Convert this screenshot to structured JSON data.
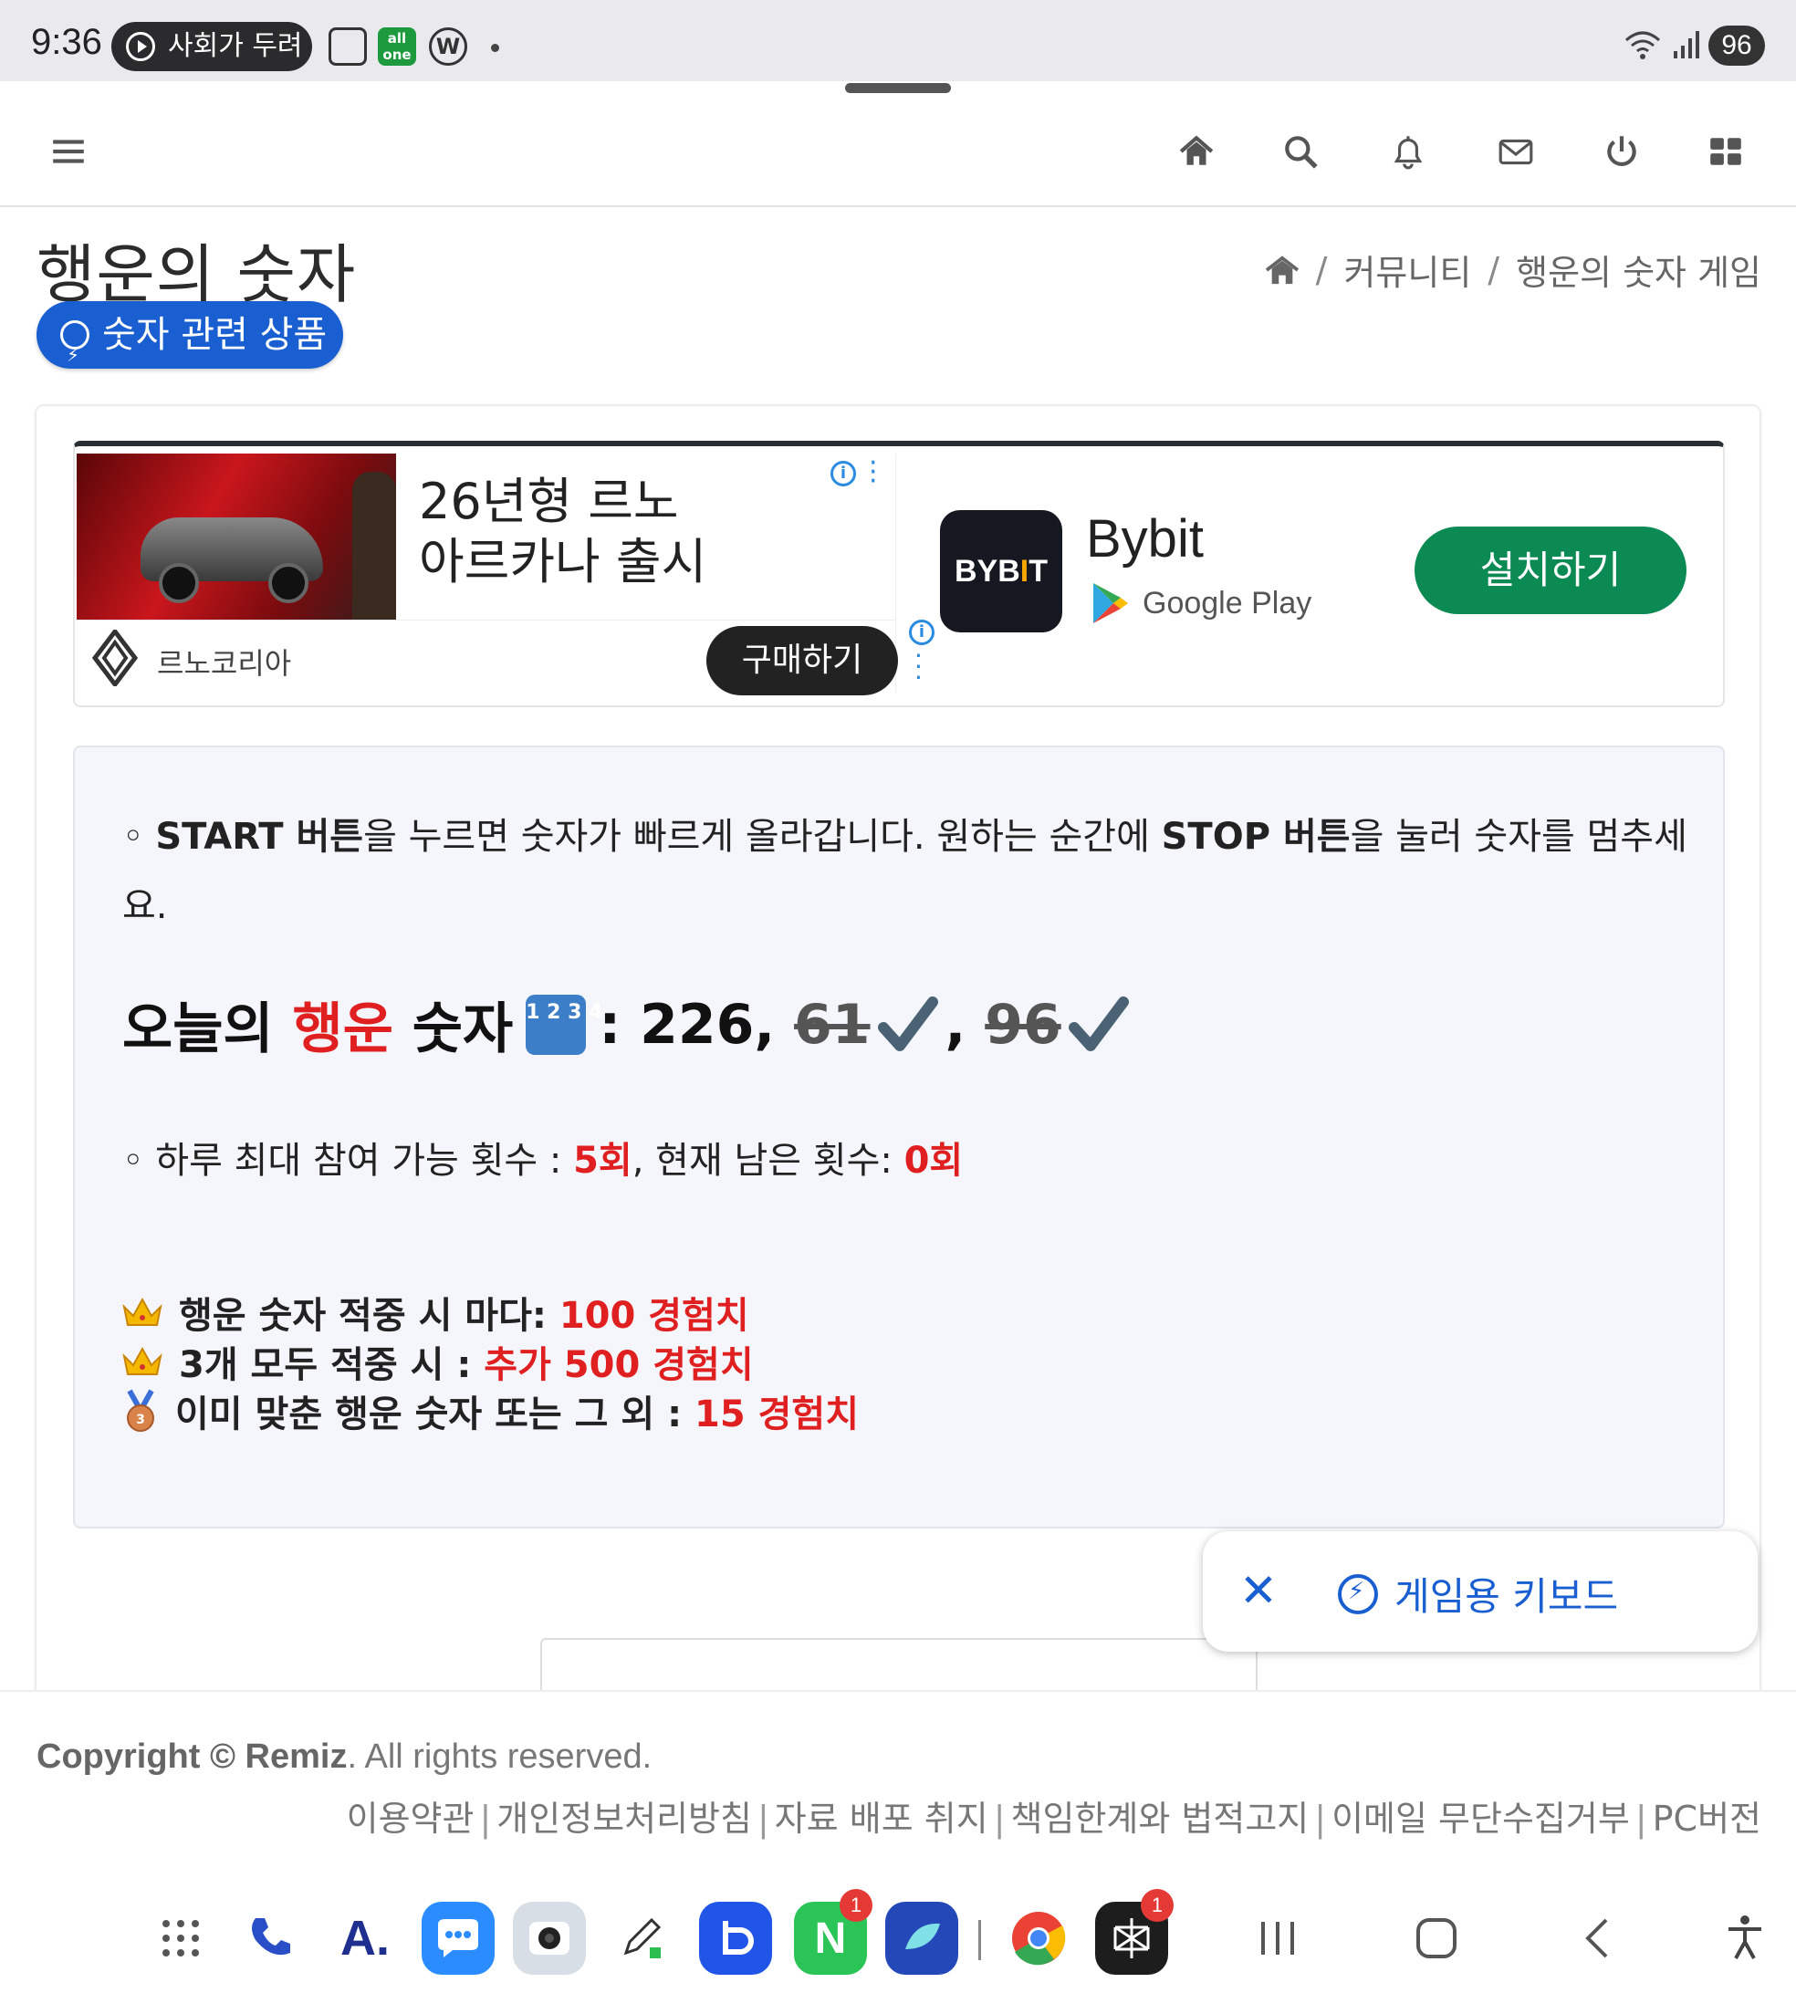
{
  "status_bar": {
    "time": "9:36",
    "media_text": "사회가 두려",
    "battery": "96"
  },
  "page": {
    "title": "행운의 숫자",
    "product_button": "숫자 관련 상품",
    "breadcrumb": [
      "커뮤니티",
      "행운의 숫자 게임"
    ]
  },
  "ad": {
    "left": {
      "headline_line1": "26년형 르노",
      "headline_line2": "아르카나 출시",
      "brand": "르노코리아",
      "cta": "구매하기"
    },
    "right": {
      "app_logo_text_a": "BYB",
      "app_logo_text_b": "I",
      "app_logo_text_c": "T",
      "app_name": "Bybit",
      "store": "Google Play",
      "cta": "설치하기"
    }
  },
  "game": {
    "instruction_bullet": "◦",
    "instruction_start": "START 버튼",
    "instruction_mid": "을 누르면 숫자가 빠르게 올라갑니다. 원하는 순간에 ",
    "instruction_stop": "STOP 버튼",
    "instruction_end": "을 눌러 숫자를 멈추세요.",
    "lucky_prefix": "오늘의",
    "lucky_red": "행운",
    "lucky_word": "숫자",
    "keycap": "1 2 3 4",
    "colon": ":",
    "number1": "226,",
    "number2": "61",
    "comma": ",",
    "number3": "96",
    "attempts_label": "◦ 하루 최대 참여 가능 횟수 : ",
    "attempts_max": "5회",
    "attempts_mid": ", 현재 남은 횟수: ",
    "attempts_left": "0회",
    "rewards": [
      {
        "icon": "crown",
        "label": "행운 숫자 적중 시 마다:",
        "value": "100 경험치"
      },
      {
        "icon": "crown",
        "label": "3개 모두 적중 시 :",
        "value": "추가 500 경험치"
      },
      {
        "icon": "medal",
        "label": "이미 맞춘 행운 숫자 또는 그 외 :",
        "value": "15 경험치"
      }
    ]
  },
  "floating": {
    "close": "✕",
    "label": "게임용 키보드"
  },
  "footer": {
    "copyright_prefix": "Copyright © ",
    "copyright_brand": "Remiz",
    "copyright_suffix": ". All rights reserved.",
    "links": [
      "이용약관",
      "개인정보처리방침",
      "자료 배포 취지",
      "책임한계와 법적고지",
      "이메일 무단수집거부",
      "PC버전"
    ]
  },
  "dock": {
    "badges": {
      "naver": "1",
      "app_last": "1"
    }
  },
  "colors": {
    "primary_blue": "#1a5fd1",
    "red_accent": "#e02020",
    "install_green": "#0b8a53"
  }
}
